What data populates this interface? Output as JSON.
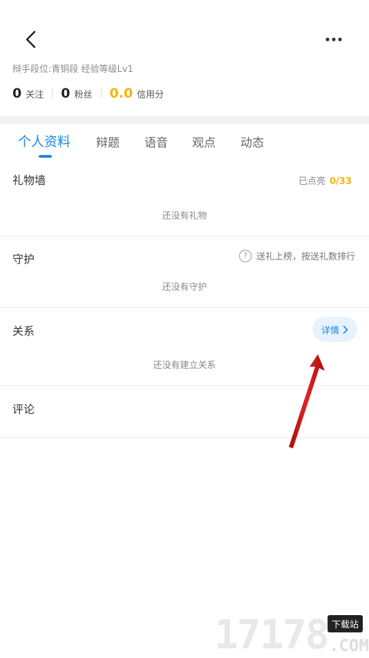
{
  "profile": {
    "rank_line": "辩手段位:青铜段 经验等级Lv1",
    "stats": [
      {
        "value": "0",
        "label": "关注"
      },
      {
        "value": "0",
        "label": "粉丝"
      },
      {
        "value": "0.0",
        "label": "信用分"
      }
    ]
  },
  "tabs": [
    {
      "label": "个人资料",
      "active": true
    },
    {
      "label": "辩题",
      "active": false
    },
    {
      "label": "语音",
      "active": false
    },
    {
      "label": "观点",
      "active": false
    },
    {
      "label": "动态",
      "active": false
    }
  ],
  "sections": {
    "gifts": {
      "title": "礼物墙",
      "lit_label": "已点亮",
      "lit_count": "0/33",
      "empty": "还没有礼物"
    },
    "guard": {
      "title": "守护",
      "hint": "送礼上榜，按送礼数排行",
      "hint_icon": "?",
      "empty": "还没有守护"
    },
    "relations": {
      "title": "关系",
      "detail_label": "详情",
      "empty": "还没有建立关系"
    },
    "comments": {
      "title": "评论"
    }
  },
  "watermark": {
    "digits": "17178",
    "tag": "下载站",
    "suffix": ".COM"
  },
  "colors": {
    "accent": "#1b87e6",
    "gold": "#f5b400",
    "arrow": "#d01f1f"
  }
}
